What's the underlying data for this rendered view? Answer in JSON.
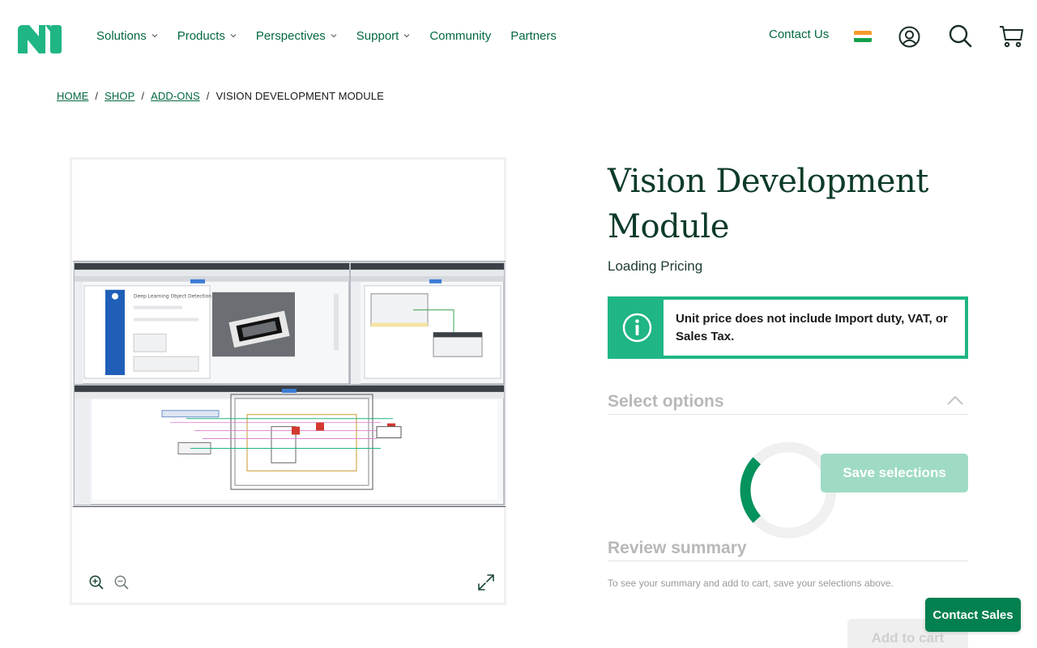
{
  "brand": {
    "logo_icon": "ni-logo-icon",
    "accent": "#03693f",
    "brand_green": "#1fb584"
  },
  "nav": {
    "items": [
      {
        "label": "Solutions",
        "has_dropdown": true
      },
      {
        "label": "Products",
        "has_dropdown": true
      },
      {
        "label": "Perspectives",
        "has_dropdown": true
      },
      {
        "label": "Support",
        "has_dropdown": true
      },
      {
        "label": "Community",
        "has_dropdown": false
      },
      {
        "label": "Partners",
        "has_dropdown": false
      }
    ],
    "contact_us": "Contact Us",
    "icons": [
      "india-flag-icon",
      "account-icon",
      "search-icon",
      "cart-icon"
    ]
  },
  "breadcrumb": {
    "items": [
      "HOME",
      "SHOP",
      "ADD-ONS"
    ],
    "current": "VISION DEVELOPMENT MODULE",
    "separator": "/"
  },
  "gallery": {
    "image_icon": "product-screenshot",
    "controls": [
      "zoom-in-icon",
      "zoom-out-icon",
      "expand-icon"
    ]
  },
  "product": {
    "title": "Vision Development Module",
    "pricing": "Loading Pricing",
    "notice": "Unit price does not include Import duty, VAT, or Sales Tax.",
    "notice_icon": "info-icon"
  },
  "options": {
    "title": "Select options",
    "save_label": "Save selections"
  },
  "summary": {
    "title": "Review summary",
    "note": "To see your summary and add to cart, save your selections above.",
    "add_to_cart": "Add to cart"
  },
  "contact_sales": "Contact Sales"
}
